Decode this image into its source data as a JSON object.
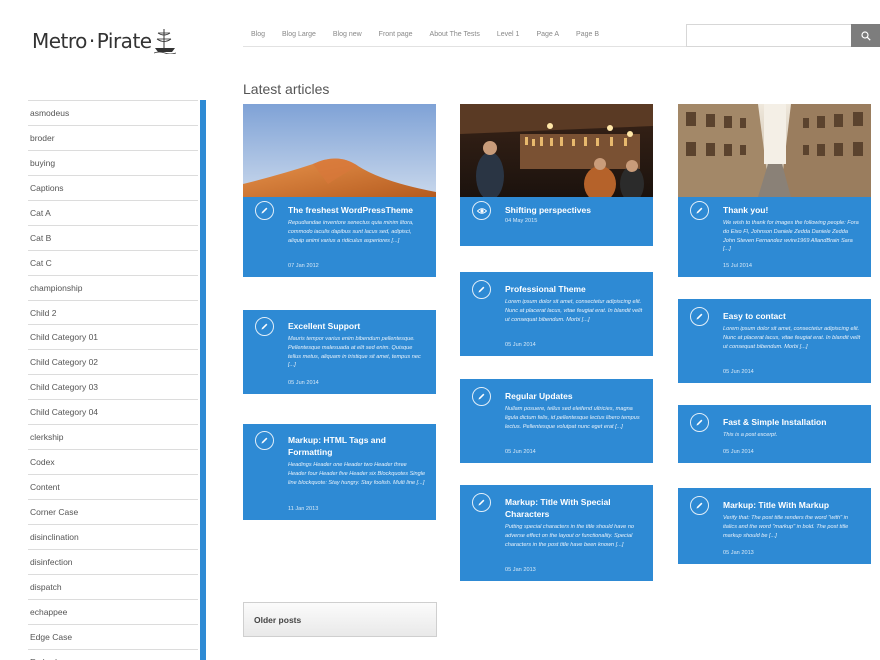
{
  "site": {
    "logo_left": "Metro",
    "logo_dot": "·",
    "logo_right": "Pirate"
  },
  "nav": [
    "Blog",
    "Blog Large",
    "Blog new",
    "Front page",
    "About The Tests",
    "Level 1",
    "Page A",
    "Page B"
  ],
  "search": {
    "placeholder": "",
    "value": ""
  },
  "sidebar": {
    "items": [
      "asmodeus",
      "broder",
      "buying",
      "Captions",
      "Cat A",
      "Cat B",
      "Cat C",
      "championship",
      "Child 2",
      "Child Category 01",
      "Child Category 02",
      "Child Category 03",
      "Child Category 04",
      "clerkship",
      "Codex",
      "Content",
      "Corner Case",
      "disinclination",
      "disinfection",
      "dispatch",
      "echappee",
      "Edge Case",
      "Embeds"
    ]
  },
  "main": {
    "heading": "Latest articles",
    "older_posts": "Older posts"
  },
  "colors": {
    "accent": "#2e8ad4"
  },
  "cards": [
    {
      "title": "The freshest WordPressTheme",
      "excerpt": "Repudiandae inventore senectus quia minim litora, commodo iaculis dapibus sunt lacus sed, adipisci, aliquip animi varius a ridiculus asperiores [...]",
      "date": "07 Jan 2012",
      "icon": "pencil-icon",
      "image": "desert-dunes"
    },
    {
      "title": "Excellent Support",
      "excerpt": "Mauris tempor varius enim bibendum pellentesque. Pellentesque malesuada at elit sed enim. Quisque tellus metus, aliquam in tristique sit amet, tempus nec [...]",
      "date": "05 Jun 2014",
      "icon": "pencil-icon"
    },
    {
      "title": "Markup: HTML Tags and Formatting",
      "excerpt": "Headings Header one Header two Header three Header four Header five Header six Blockquotes Single line blockquote: Stay hungry. Stay foolish. Multi line [...]",
      "date": "11 Jan 2013",
      "icon": "pencil-icon"
    },
    {
      "title": "Shifting perspectives",
      "excerpt": "",
      "date": "04 May 2015",
      "icon": "eye-icon",
      "image": "bar-interior"
    },
    {
      "title": "Professional Theme",
      "excerpt": "Lorem ipsum dolor sit amet, consectetur adipiscing elit. Nunc at placerat lacus, vitae feugiat erat. In blandit velit ut consequat bibendum. Morbi [...]",
      "date": "05 Jun 2014",
      "icon": "pencil-icon"
    },
    {
      "title": "Regular Updates",
      "excerpt": "Nullam posuere, tellus sed eleifend ultricies, magna ligula dictum felis, id pellentesque lectus libero tempus lectus. Pellentesque volutpat nunc eget erat [...]",
      "date": "05 Jun 2014",
      "icon": "pencil-icon"
    },
    {
      "title": "Markup: Title With Special Characters",
      "excerpt": "Putting special characters in the title should have no adverse effect on the layout or functionality. Special characters in the post title have been known [...]",
      "date": "05 Jan 2013",
      "icon": "pencil-icon"
    },
    {
      "title": "Thank you!",
      "excerpt": "We wish to thank for images the following people: Fora do Eixo Fl, Johnson Daniele Zedda Daniele Zedda John Steven Fernandez wvire1969 AllandBrain Sara [...]",
      "date": "15 Jul 2014",
      "icon": "pencil-icon",
      "image": "narrow-street"
    },
    {
      "title": "Easy to contact",
      "excerpt": "Lorem ipsum dolor sit amet, consectetur adipiscing elit. Nunc at placerat lacus, vitae feugiat erat. In blandit velit ut consequat bibendum. Morbi [...]",
      "date": "05 Jun 2014",
      "icon": "pencil-icon"
    },
    {
      "title": "Fast & Simple Installation",
      "excerpt": "This is a post excerpt.",
      "date": "05 Jun 2014",
      "icon": "pencil-icon"
    },
    {
      "title": "Markup: Title With Markup",
      "excerpt": "Verify that: The post title renders the word \"with\" in italics and the word \"markup\" in bold. The post title markup should be [...]",
      "date": "05 Jan 2013",
      "icon": "pencil-icon"
    }
  ]
}
